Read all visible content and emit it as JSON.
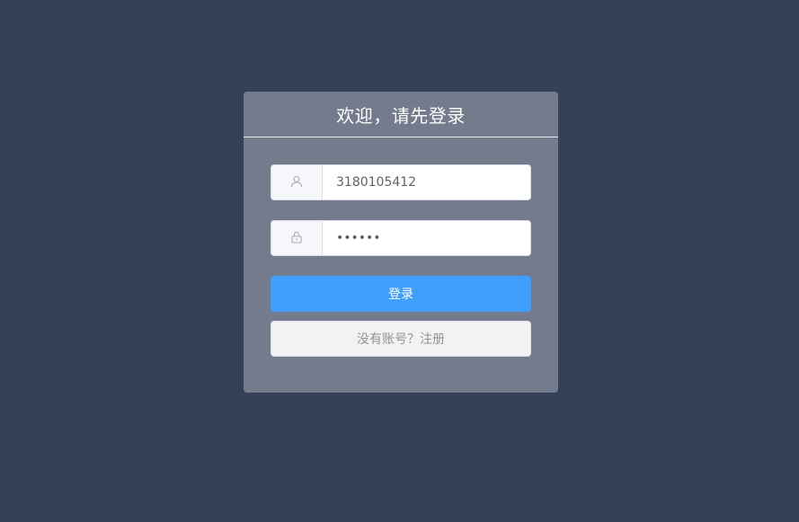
{
  "card": {
    "title": "欢迎，请先登录"
  },
  "username": {
    "icon": "user-icon",
    "value": "3180105412"
  },
  "password": {
    "icon": "lock-icon",
    "value": "••••••"
  },
  "buttons": {
    "login_label": "登录",
    "register_label": "没有账号？注册"
  },
  "colors": {
    "background": "#344158",
    "card": "#737b8c",
    "primary": "#409eff",
    "secondary_button": "#f2f2f2"
  }
}
